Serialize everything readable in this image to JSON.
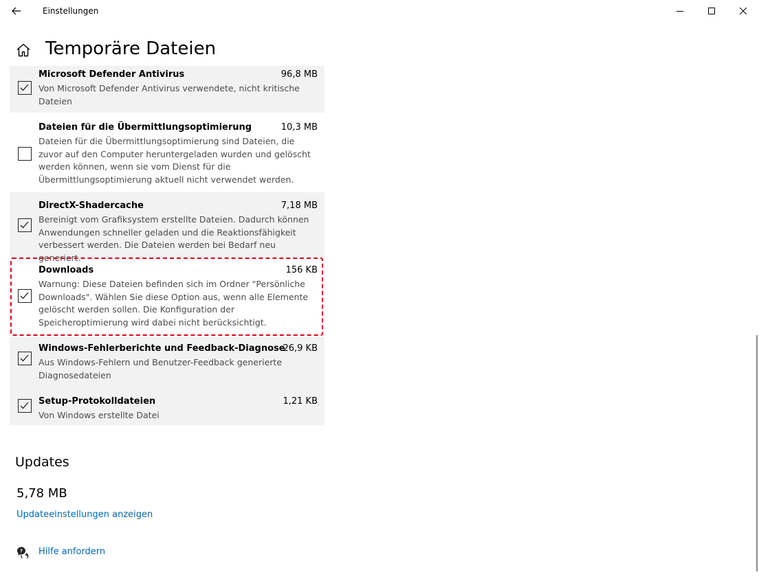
{
  "window": {
    "title": "Einstellungen",
    "icons": {
      "back": "arrow-left-icon",
      "minimize": "minimize-icon",
      "maximize": "maximize-icon",
      "close": "close-icon"
    }
  },
  "page": {
    "title": "Temporäre Dateien",
    "home_icon": "home-icon"
  },
  "items": [
    {
      "name": "Microsoft Defender Antivirus",
      "size": "96,8 MB",
      "desc": "Von Microsoft Defender Antivirus verwendete, nicht kritische Dateien",
      "checked": true
    },
    {
      "name": "Dateien für die Übermittlungsoptimierung",
      "size": "10,3 MB",
      "desc": "Dateien für die Übermittlungsoptimierung sind Dateien, die zuvor auf den Computer heruntergeladen wurden und gelöscht werden können, wenn sie vom Dienst für die Übermittlungsoptimierung aktuell nicht verwendet werden.",
      "checked": false
    },
    {
      "name": "DirectX-Shadercache",
      "size": "7,18 MB",
      "desc": "Bereinigt vom Grafiksystem erstellte Dateien. Dadurch können Anwendungen schneller geladen und die Reaktionsfähigkeit verbessert werden. Die Dateien werden bei Bedarf neu generiert.",
      "checked": true
    },
    {
      "name": "Downloads",
      "size": "156 KB",
      "desc": "Warnung: Diese Dateien befinden sich im Ordner \"Persönliche Downloads\". Wählen Sie diese Option aus, wenn alle Elemente gelöscht werden sollen. Die Konfiguration der Speicheroptimierung wird dabei nicht berücksichtigt.",
      "checked": true
    },
    {
      "name": "Windows-Fehlerberichte und Feedback-Diagnose",
      "size": "26,9 KB",
      "desc": "Aus Windows-Fehlern und Benutzer-Feedback generierte Diagnosedateien",
      "checked": true
    },
    {
      "name": "Setup-Protokolldateien",
      "size": "1,21 KB",
      "desc": "Von Windows erstellte Datei",
      "checked": true
    }
  ],
  "updates": {
    "title": "Updates",
    "size": "5,78 MB",
    "link": "Updateeinstellungen anzeigen"
  },
  "help": {
    "label": "Hilfe anfordern",
    "icon": "help-chat-icon"
  },
  "colors": {
    "link": "#0067b8",
    "highlight": "#e2001a",
    "row_shade": "#f2f2f2"
  }
}
